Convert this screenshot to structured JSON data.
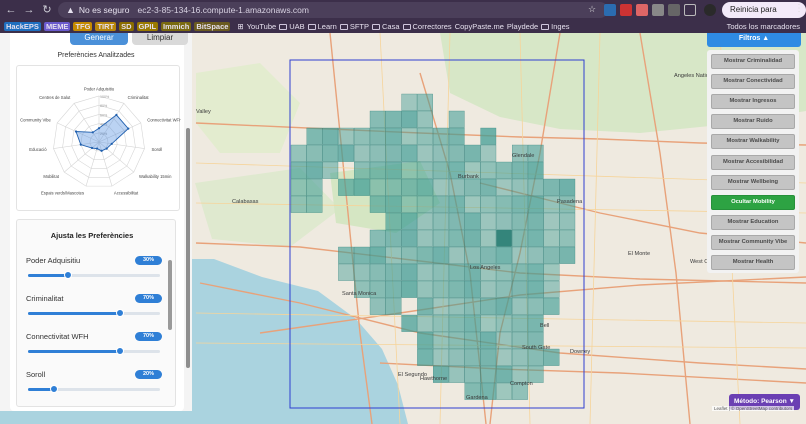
{
  "browser": {
    "omnibox": {
      "insecure_label": "No es seguro",
      "url": "ec2-3-85-134-16.compute-1.amazonaws.com"
    },
    "update_button": "Reinicia para actualizar",
    "bookmarks": [
      {
        "label": "HackEPS",
        "kind": "tag",
        "color": "#1f6fbf"
      },
      {
        "label": "MEME",
        "kind": "tag",
        "color": "#6a5acd"
      },
      {
        "label": "TFG",
        "kind": "tag",
        "color": "#c48a00"
      },
      {
        "label": "TIRT",
        "kind": "tag",
        "color": "#b8860b"
      },
      {
        "label": "SD",
        "kind": "tag",
        "color": "#8a6d00"
      },
      {
        "label": "GPIL",
        "kind": "tag",
        "color": "#9a7a00"
      },
      {
        "label": "Immich",
        "kind": "tag",
        "color": "#7a6a10"
      },
      {
        "label": "BitSpace",
        "kind": "tag",
        "color": "#6a5a20"
      },
      {
        "label": "YouTube",
        "kind": "link"
      },
      {
        "label": "UAB",
        "kind": "folder"
      },
      {
        "label": "Learn",
        "kind": "folder"
      },
      {
        "label": "SFTP",
        "kind": "folder"
      },
      {
        "label": "Casa",
        "kind": "folder"
      },
      {
        "label": "Correctores",
        "kind": "folder"
      },
      {
        "label": "CopyPaste.me",
        "kind": "link"
      },
      {
        "label": "Playdede",
        "kind": "link"
      },
      {
        "label": "Inges",
        "kind": "folder"
      }
    ],
    "all_bookmarks": "Todos los marcadores"
  },
  "sidebar": {
    "generar_label": "Generar",
    "limpiar_label": "Limpiar",
    "preferences_title": "Preferències Analitzades",
    "radar_axes": [
      "Poder Adquisitiu",
      "Criminalitat",
      "Connectivitat WFH",
      "Soroll",
      "Walkability 15min",
      "Accessibilitat",
      "Espais verds/Mascotes",
      "Mobilitat",
      "Educació",
      "Community Vibe",
      "Centres de Salut"
    ],
    "radar_ticks": [
      "100%",
      "80%",
      "60%",
      "40%",
      "20%"
    ],
    "radar_values": [
      0.3,
      0.7,
      0.7,
      0.28,
      0.22,
      0.2,
      0.15,
      0.2,
      0.4,
      0.55,
      0.25
    ],
    "adjust_title": "Ajusta les Preferències",
    "sliders": [
      {
        "label": "Poder Adquisitiu",
        "value_label": "30%",
        "value": 0.3
      },
      {
        "label": "Criminalitat",
        "value_label": "70%",
        "value": 0.7
      },
      {
        "label": "Connectivitat WFH",
        "value_label": "70%",
        "value": 0.7
      },
      {
        "label": "Soroll",
        "value_label": "20%",
        "value": 0.2
      }
    ]
  },
  "filters": {
    "header": "Filtros ▲",
    "buttons": [
      {
        "label": "Mostrar Criminalidad",
        "active": false
      },
      {
        "label": "Mostrar Conectividad",
        "active": false
      },
      {
        "label": "Mostrar Ingresos",
        "active": false
      },
      {
        "label": "Mostrar Ruido",
        "active": false
      },
      {
        "label": "Mostrar Walkability",
        "active": false
      },
      {
        "label": "Mostrar Accesibilidad",
        "active": false
      },
      {
        "label": "Mostrar Wellbeing",
        "active": false
      },
      {
        "label": "Ocultar Mobility",
        "active": true
      },
      {
        "label": "Mostrar Education",
        "active": false
      },
      {
        "label": "Mostrar Community Vibe",
        "active": false
      },
      {
        "label": "Mostrar Health",
        "active": false
      }
    ]
  },
  "map": {
    "place_labels": [
      "Valley",
      "Burbank",
      "Pasadena",
      "Calabasas",
      "Glendale",
      "Santa Monica",
      "Los Angeles",
      "El Monte",
      "West Covina",
      "El Segundo",
      "South Gate",
      "Downey",
      "Hawthorne",
      "Compton",
      "Gardena",
      "Bell",
      "Angeles National Forest"
    ],
    "method_button": "Método: Pearson ▼",
    "attribution": "Leaflet | © OpenStreetMap contributors"
  },
  "colors": {
    "accent": "#2f7fd6",
    "active_filter": "#2da343",
    "method": "#6b3fb3",
    "heat_cell": "#3f9c95"
  }
}
